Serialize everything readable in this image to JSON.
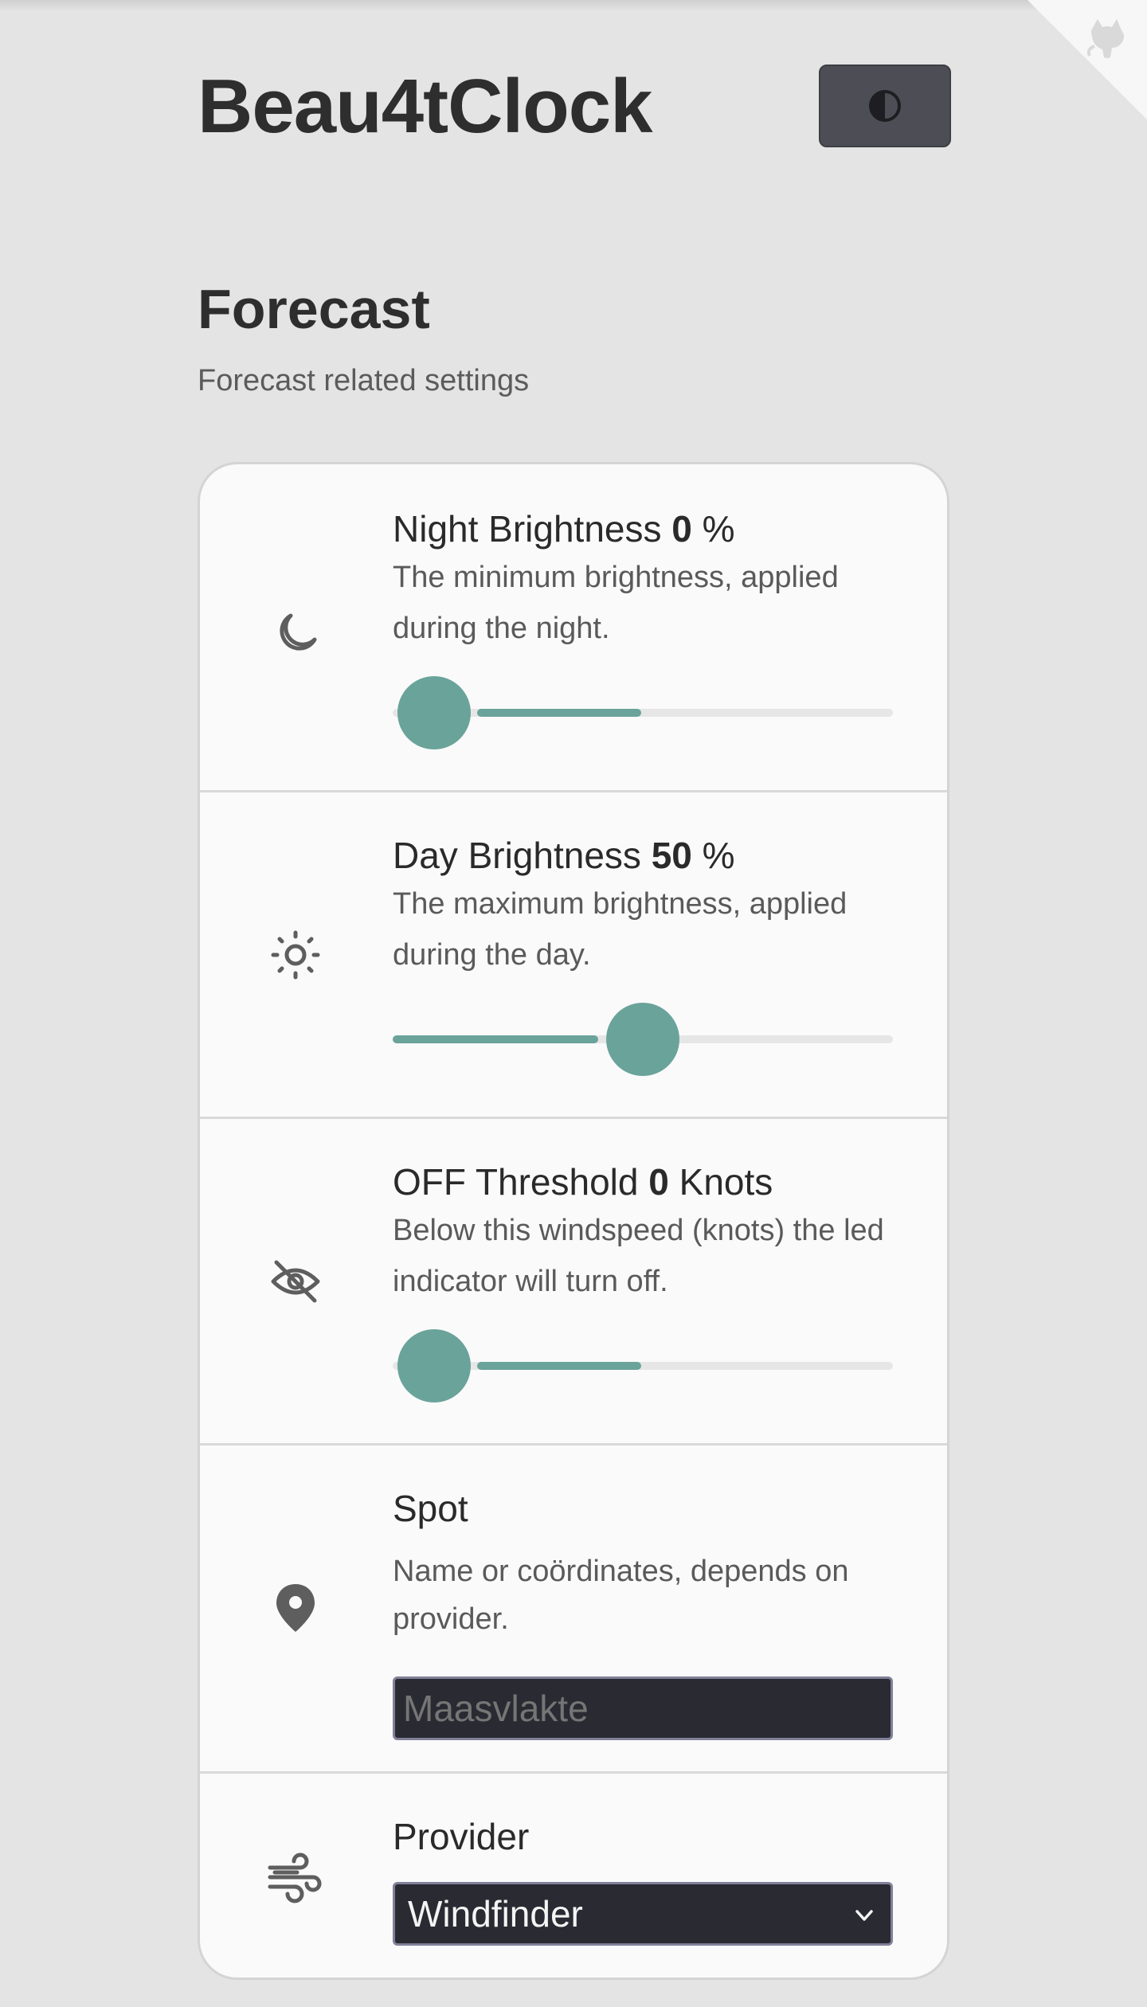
{
  "app": {
    "title": "Beau4tClock",
    "theme_toggle_icon": "contrast-icon",
    "corner_icon": "github-cat-icon"
  },
  "section": {
    "title": "Forecast",
    "subtitle": "Forecast related settings"
  },
  "settings": {
    "night_brightness": {
      "icon": "moon-icon",
      "label_prefix": "Night Brightness ",
      "value": "0",
      "unit": " %",
      "description": "The minimum brightness, applied during the night.",
      "slider_fraction": 0.0
    },
    "day_brightness": {
      "icon": "sun-icon",
      "label_prefix": "Day Brightness ",
      "value": "50",
      "unit": " %",
      "description": "The maximum brightness, applied during the day.",
      "slider_fraction": 0.5
    },
    "off_threshold": {
      "icon": "eye-off-icon",
      "label_prefix": "OFF Threshold ",
      "value": "0",
      "unit": " Knots",
      "description": "Below this windspeed (knots) the led indicator will turn off.",
      "slider_fraction": 0.0
    },
    "spot": {
      "icon": "location-pin-icon",
      "label": "Spot",
      "description": "Name or coördinates, depends on provider.",
      "placeholder": "Maasvlakte",
      "value": ""
    },
    "provider": {
      "icon": "wind-icon",
      "label": "Provider",
      "selected": "Windfinder"
    }
  },
  "colors": {
    "accent": "#6aa39a",
    "background": "#e4e4e4",
    "card": "#fafafa",
    "field": "#2a2a33"
  }
}
